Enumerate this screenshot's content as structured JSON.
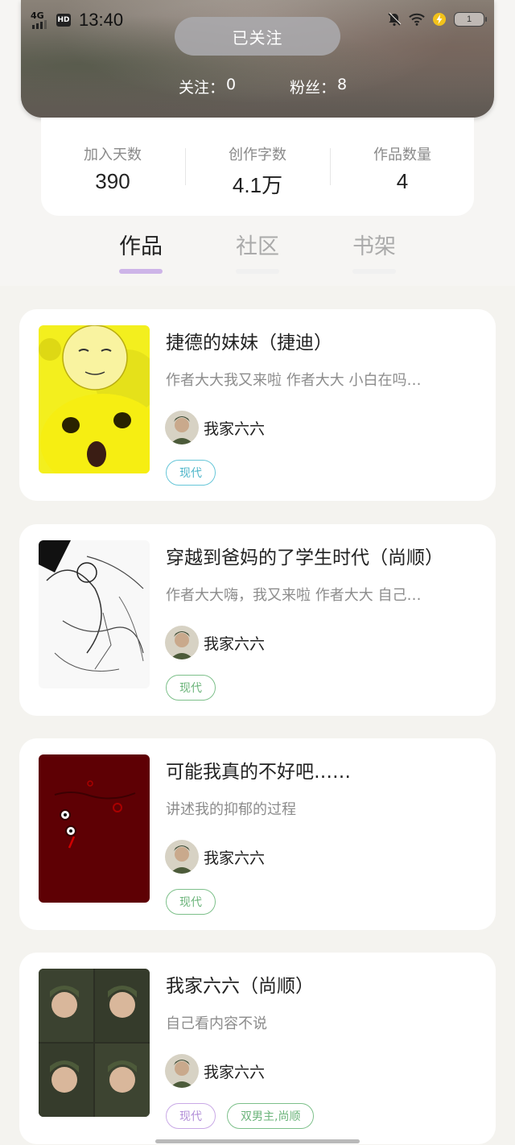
{
  "status_bar": {
    "network": "4G",
    "hd": "HD",
    "time": "13:40",
    "battery": "1"
  },
  "profile": {
    "follow_button": "已关注",
    "following_label": "关注：",
    "following_count": "0",
    "fans_label": "粉丝：",
    "fans_count": "8"
  },
  "stats": [
    {
      "label": "加入天数",
      "value": "390"
    },
    {
      "label": "创作字数",
      "value": "4.1万"
    },
    {
      "label": "作品数量",
      "value": "4"
    }
  ],
  "tabs": [
    {
      "label": "作品",
      "active": true
    },
    {
      "label": "社区",
      "active": false
    },
    {
      "label": "书架",
      "active": false
    }
  ],
  "works": [
    {
      "title": "捷德的妹妹（捷迪）",
      "desc": "作者大大我又来啦  作者大大  小白在吗…",
      "author": "我家六六",
      "tags": [
        {
          "label": "现代",
          "color": "#4fb6ca"
        }
      ]
    },
    {
      "title": "穿越到爸妈的了学生时代（尚顺）",
      "desc": "作者大大嗨，我又来啦  作者大大  自己…",
      "author": "我家六六",
      "tags": [
        {
          "label": "现代",
          "color": "#6bb47a"
        }
      ]
    },
    {
      "title": "可能我真的不好吧……",
      "desc": "讲述我的抑郁的过程",
      "author": "我家六六",
      "tags": [
        {
          "label": "现代",
          "color": "#6bb47a"
        }
      ]
    },
    {
      "title": "我家六六（尚顺）",
      "desc": "自己看内容不说",
      "author": "我家六六",
      "tags": [
        {
          "label": "现代",
          "color": "#b28ed8"
        },
        {
          "label": "双男主,尚顺",
          "color": "#6bb47a"
        }
      ]
    }
  ],
  "colors": {
    "tab_indicator": "#cdb4e8",
    "page_bg": "#f4f3ef"
  }
}
